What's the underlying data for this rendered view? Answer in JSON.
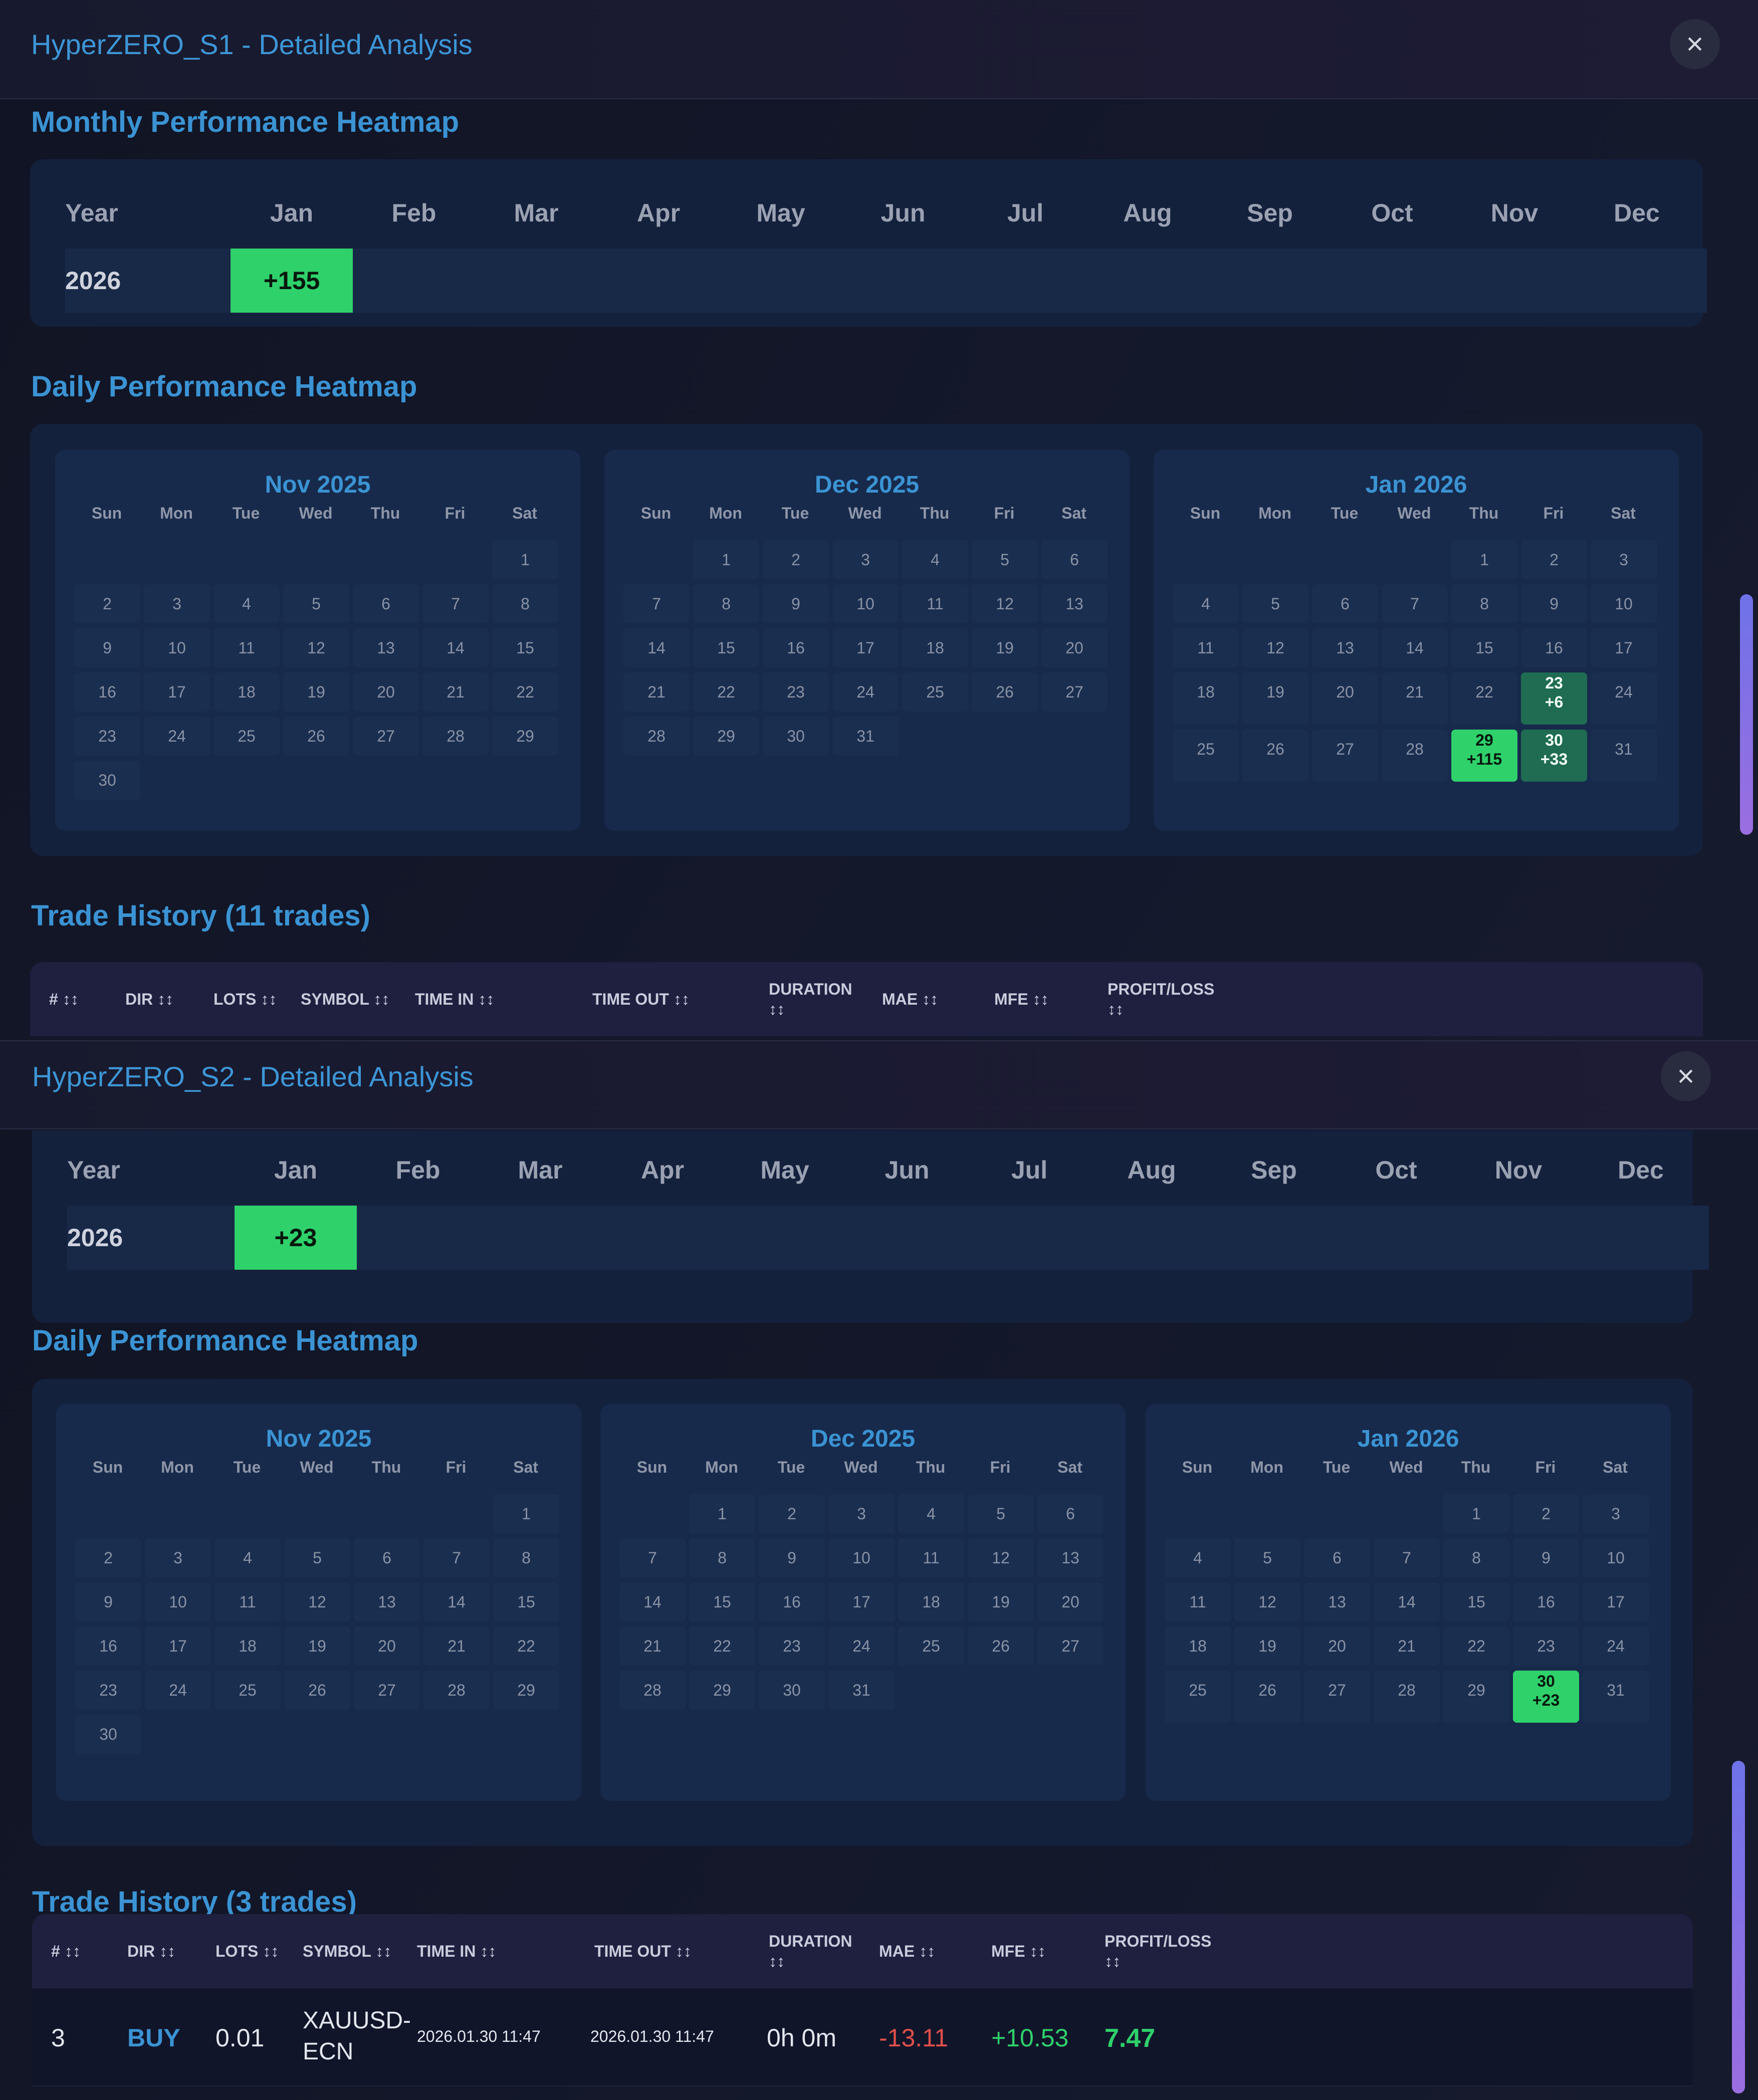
{
  "months": [
    "Jan",
    "Feb",
    "Mar",
    "Apr",
    "May",
    "Jun",
    "Jul",
    "Aug",
    "Sep",
    "Oct",
    "Nov",
    "Dec"
  ],
  "weekdays": [
    "Sun",
    "Mon",
    "Tue",
    "Wed",
    "Thu",
    "Fri",
    "Sat"
  ],
  "close_icon": "close-icon",
  "table_headers": [
    {
      "key": "num",
      "label": "# ↕↕"
    },
    {
      "key": "dir",
      "label": "DIR ↕↕"
    },
    {
      "key": "lots",
      "label": "LOTS ↕↕"
    },
    {
      "key": "symbol",
      "label": "SYMBOL ↕↕"
    },
    {
      "key": "time_in",
      "label": "TIME IN ↕↕"
    },
    {
      "key": "time_out",
      "label": "TIME OUT ↕↕"
    },
    {
      "key": "duration",
      "label": "DURATION\n↕↕"
    },
    {
      "key": "mae",
      "label": "MAE ↕↕"
    },
    {
      "key": "mfe",
      "label": "MFE ↕↕"
    },
    {
      "key": "pl",
      "label": "PROFIT/LOSS\n↕↕"
    }
  ],
  "colors": {
    "accent": "#3b93d3",
    "positive": "#2fd16b",
    "positive_dim": "#1f6c52",
    "negative": "#e0504a",
    "buy": "#3b93d3"
  },
  "modal1": {
    "title": "HyperZERO_S1 - Detailed Analysis",
    "monthly_heading": "Monthly Performance Heatmap",
    "year_label": "Year",
    "monthly_rows": [
      {
        "year": "2026",
        "values": {
          "Jan": "+155"
        }
      }
    ],
    "daily_heading": "Daily Performance Heatmap",
    "calendars": [
      {
        "title": "Nov 2025",
        "first_weekday": 6,
        "days": 30,
        "results": {}
      },
      {
        "title": "Dec 2025",
        "first_weekday": 1,
        "days": 31,
        "results": {}
      },
      {
        "title": "Jan 2026",
        "first_weekday": 4,
        "days": 31,
        "results": {
          "23": {
            "value": "+6",
            "level": "mid"
          },
          "29": {
            "value": "+115",
            "level": "high"
          },
          "30": {
            "value": "+33",
            "level": "mid"
          }
        }
      }
    ],
    "trade_heading": "Trade History (11 trades)",
    "trades": []
  },
  "modal2": {
    "title": "HyperZERO_S2 - Detailed Analysis",
    "year_label": "Year",
    "monthly_rows": [
      {
        "year": "2026",
        "values": {
          "Jan": "+23"
        }
      }
    ],
    "daily_heading": "Daily Performance Heatmap",
    "calendars": [
      {
        "title": "Nov 2025",
        "first_weekday": 6,
        "days": 30,
        "results": {}
      },
      {
        "title": "Dec 2025",
        "first_weekday": 1,
        "days": 31,
        "results": {}
      },
      {
        "title": "Jan 2026",
        "first_weekday": 4,
        "days": 31,
        "results": {
          "30": {
            "value": "+23",
            "level": "high"
          }
        }
      }
    ],
    "trade_heading": "Trade History (3 trades)",
    "trades": [
      {
        "num": "3",
        "dir": "BUY",
        "lots": "0.01",
        "symbol": "XAUUSD-\nECN",
        "time_in": "2026.01.30 11:47",
        "time_out": "2026.01.30 11:47",
        "duration": "0h 0m",
        "mae": "-13.11",
        "mfe": "+10.53",
        "pl": "7.47"
      }
    ]
  }
}
